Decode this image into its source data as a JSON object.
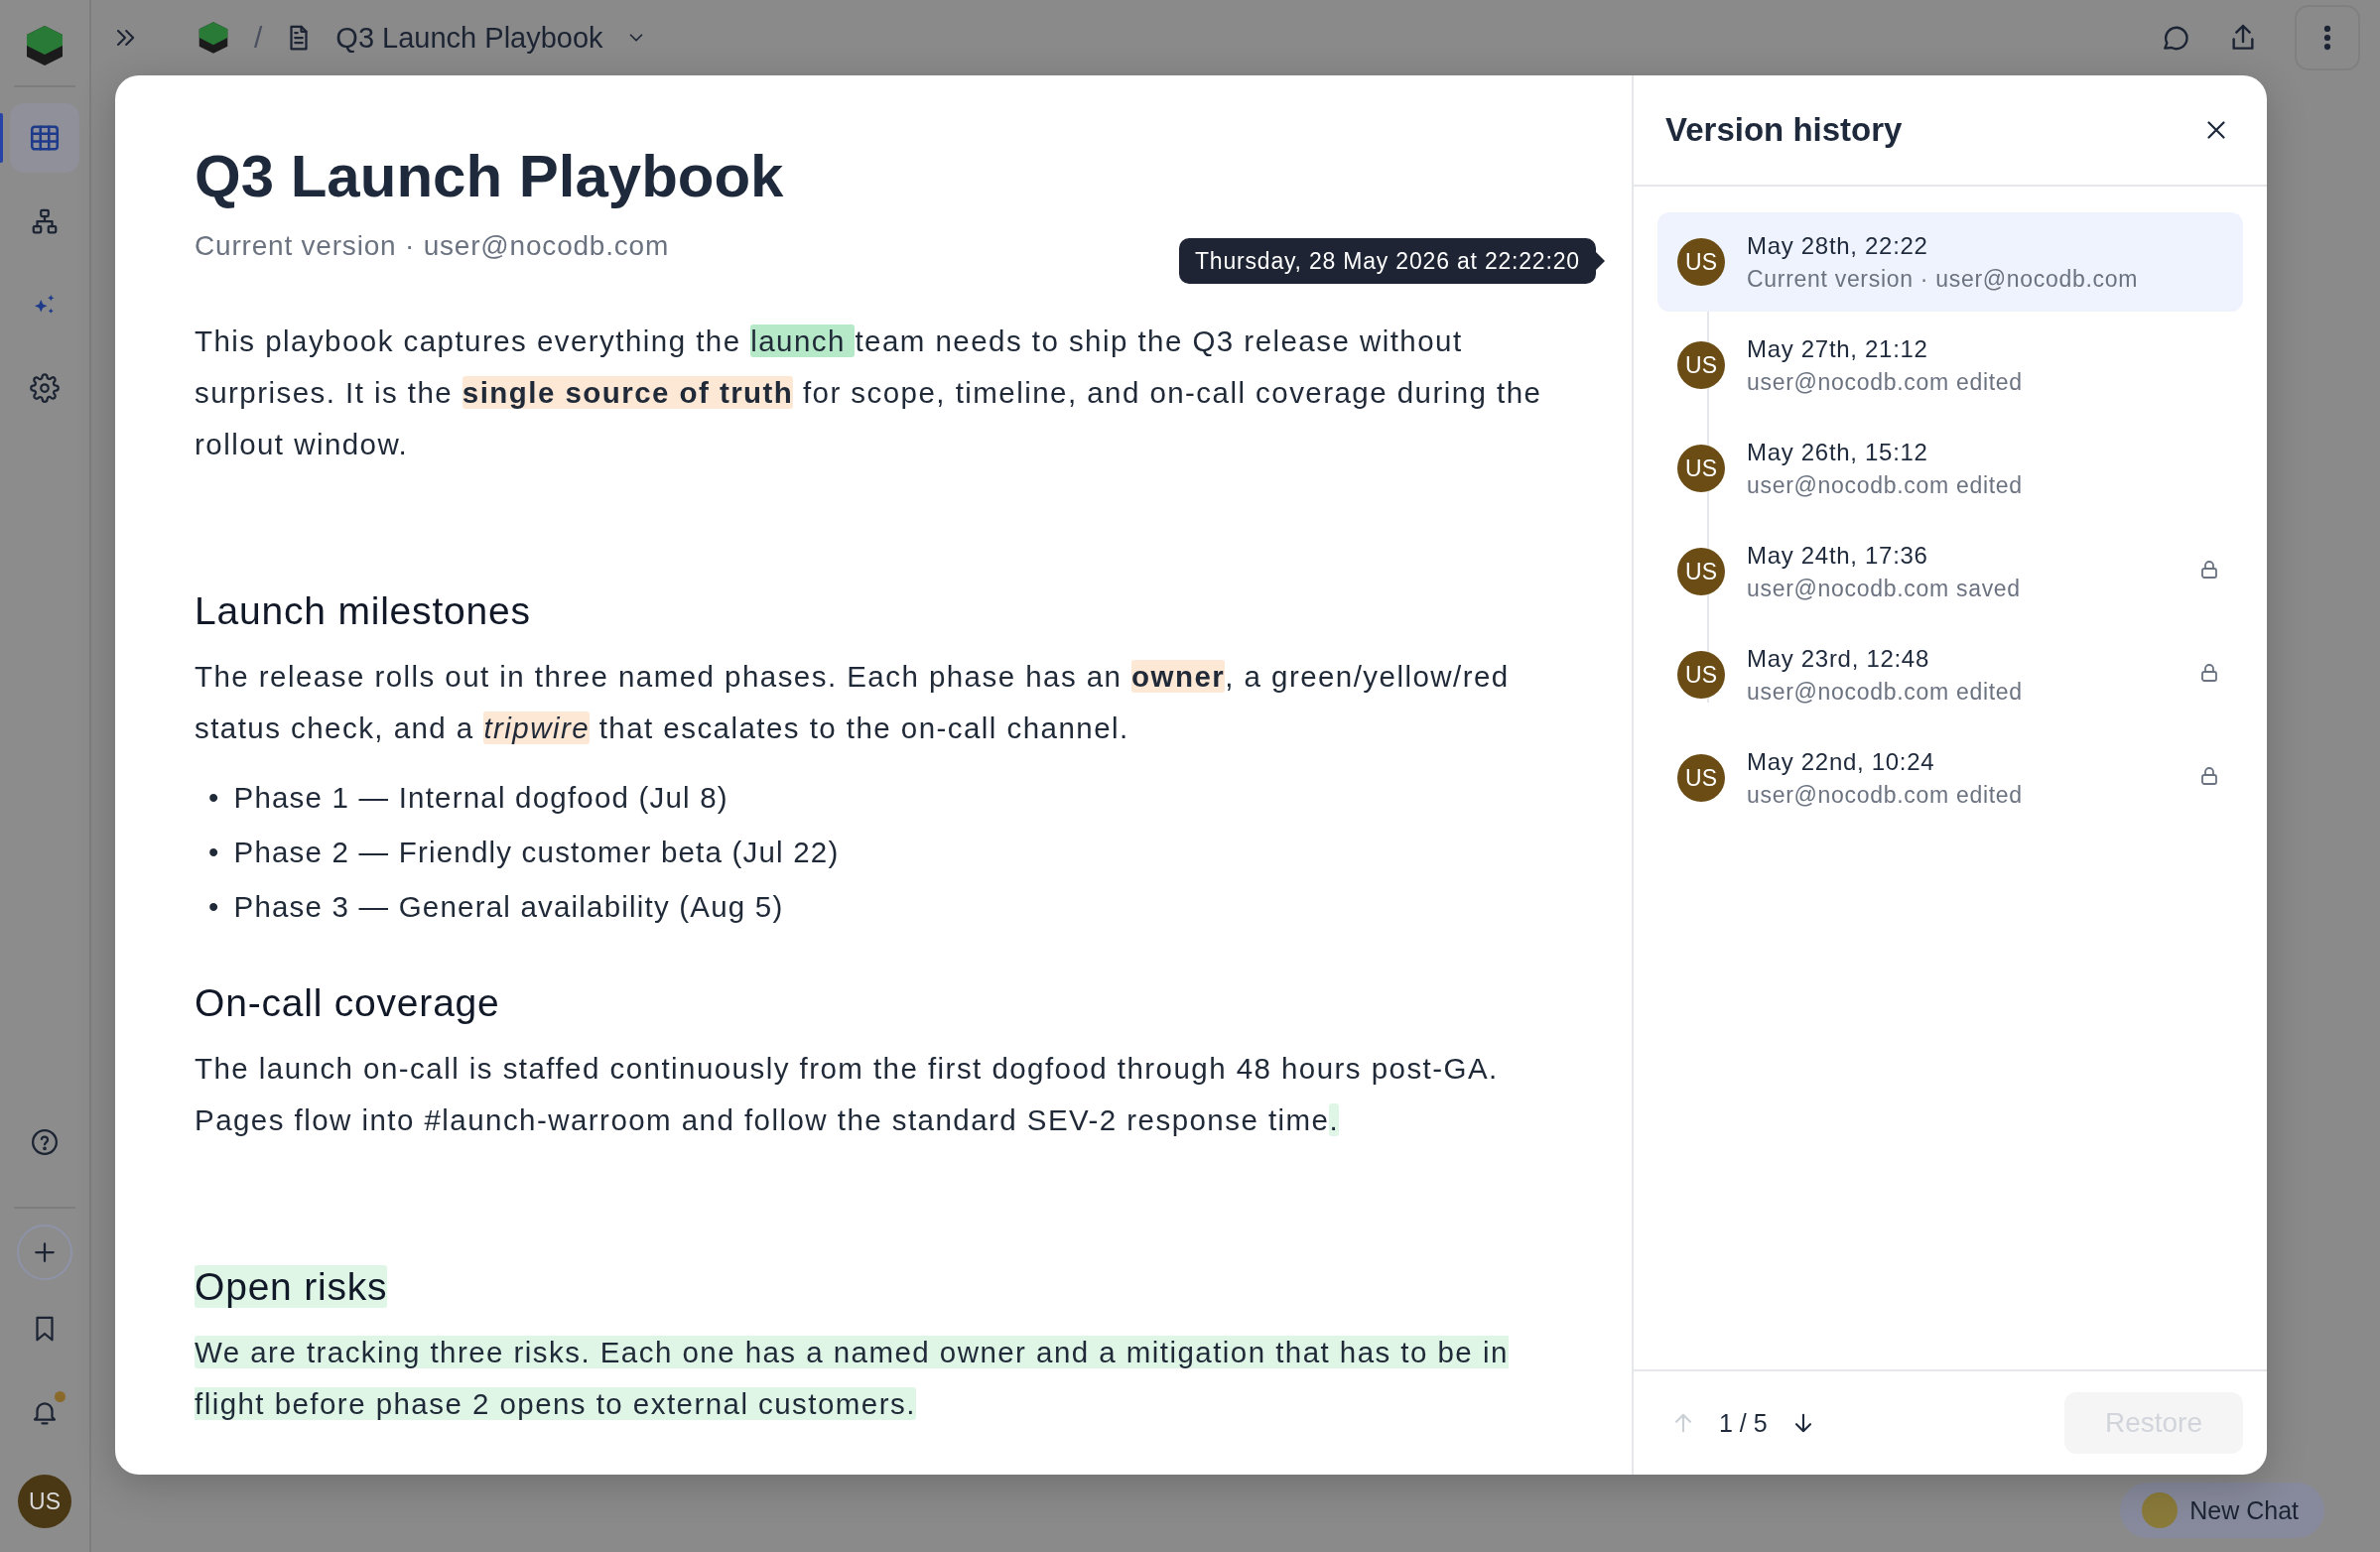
{
  "sidebar": {
    "nav": [
      {
        "kind": "grid",
        "selected": true
      },
      {
        "kind": "schema",
        "selected": false
      },
      {
        "kind": "ai",
        "selected": false
      },
      {
        "kind": "settings",
        "selected": false
      }
    ],
    "bottom": [
      {
        "kind": "help"
      },
      {
        "kind": "add"
      },
      {
        "kind": "bookmark"
      },
      {
        "kind": "bell",
        "unread": true
      }
    ],
    "avatar": "US"
  },
  "breadcrumb": {
    "separator": "/",
    "title": "Q3 Launch Playbook"
  },
  "document": {
    "title": "Q3 Launch Playbook",
    "subtitle": "Current version · user@nocodb.com",
    "blocks": [
      {
        "kind": "paragraph",
        "runs": [
          {
            "text": "This playbook captures everything the "
          },
          {
            "text": "launch ",
            "kind": "inserted"
          },
          {
            "text": "team needs to ship the Q3 release without surprises. It is the "
          },
          {
            "text": "**single source of truth**",
            "kind": "modified"
          },
          {
            "text": " for scope, timeline, and on-call coverage during the rollout window."
          }
        ]
      },
      {
        "kind": "heading",
        "runs": [
          {
            "text": "Launch milestones"
          }
        ]
      },
      {
        "kind": "paragraph",
        "runs": [
          {
            "text": "The release rolls out in three named phases. Each phase has an "
          },
          {
            "text": "**owner**",
            "kind": "modified"
          },
          {
            "text": ", a green/yellow/red status check, and a "
          },
          {
            "text": "*tripwire*",
            "kind": "modified"
          },
          {
            "text": " that escalates to the on-call channel."
          }
        ]
      },
      {
        "kind": "bullets",
        "items": [
          {
            "marker": "•",
            "text": "Phase 1 — Internal dogfood (Jul 8)"
          },
          {
            "marker": "•",
            "text": "Phase 2 — Friendly customer beta (Jul 22)"
          },
          {
            "marker": "•",
            "text": "Phase 3 — General availability (Aug 5)"
          }
        ]
      },
      {
        "kind": "heading",
        "runs": [
          {
            "text": "On-call coverage"
          }
        ]
      },
      {
        "kind": "paragraph",
        "runs": [
          {
            "text": "The launch on-call is staffed continuously from the first dogfood through 48 hours post-GA. Pages flow into #launch-warroom and follow the standard SEV-2 response time"
          },
          {
            "text": ".",
            "kind": "inserted_block"
          }
        ]
      },
      {
        "kind": "heading",
        "runs": [
          {
            "text": "Open risks",
            "kind": "inserted_block"
          }
        ]
      },
      {
        "kind": "paragraph",
        "runs": [
          {
            "text": "We are tracking three risks. Each one has a named owner and a mitigation that has to be in flight before phase 2 opens to external customers.",
            "kind": "inserted_block"
          }
        ]
      }
    ]
  },
  "tooltip": "Thursday, 28 May 2026 at 22:22:20",
  "version_history": {
    "title": "Version history",
    "versions": [
      {
        "date": "May 28th, 22:22",
        "detail": "Current version · user@nocodb.com",
        "avatar": "US",
        "selected": true,
        "locked": false
      },
      {
        "date": "May 27th, 21:12",
        "detail": "user@nocodb.com edited",
        "avatar": "US",
        "selected": false,
        "locked": false
      },
      {
        "date": "May 26th, 15:12",
        "detail": "user@nocodb.com edited",
        "avatar": "US",
        "selected": false,
        "locked": false
      },
      {
        "date": "May 24th, 17:36",
        "detail": "user@nocodb.com saved",
        "avatar": "US",
        "selected": false,
        "locked": true
      },
      {
        "date": "May 23rd, 12:48",
        "detail": "user@nocodb.com edited",
        "avatar": "US",
        "selected": false,
        "locked": true
      },
      {
        "date": "May 22nd, 10:24",
        "detail": "user@nocodb.com edited",
        "avatar": "US",
        "selected": false,
        "locked": true
      }
    ],
    "pager": {
      "counter": "1 / 5",
      "prev_disabled": true,
      "next_disabled": false
    },
    "restore": {
      "label": "Restore",
      "disabled": true
    }
  },
  "chat_button": "New Chat"
}
